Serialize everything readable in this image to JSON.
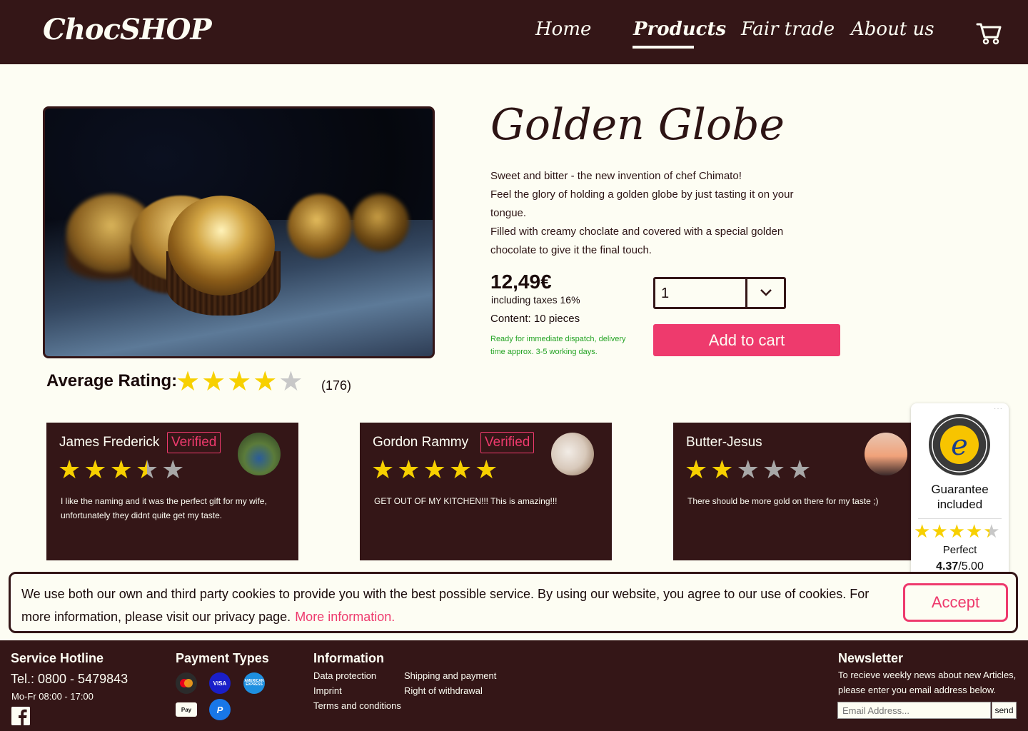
{
  "header": {
    "logo": "ChocSHOP",
    "nav": [
      {
        "label": "Home"
      },
      {
        "label": "Products",
        "active": true
      },
      {
        "label": "Fair trade"
      },
      {
        "label": "About us"
      }
    ],
    "cart_icon": "shopping-cart-icon"
  },
  "product": {
    "title": "Golden Globe",
    "description": [
      "Sweet and bitter - the new invention of chef Chimato!",
      "Feel the glory of holding a golden globe by just tasting it on your tongue.",
      "Filled with creamy choclate and covered with a special golden chocolate to give it the final touch."
    ],
    "price": "12,49€",
    "tax": "including taxes 16%",
    "content": "Content: 10 pieces",
    "dispatch": "Ready for immediate dispatch, delivery time approx. 3-5 working days.",
    "quantity": "1",
    "add_to_cart": "Add to cart"
  },
  "rating": {
    "label": "Average Rating:",
    "stars": 4,
    "max": 5,
    "count": "(176)"
  },
  "reviews": [
    {
      "name": "James Frederick",
      "verified": "Verified",
      "stars": 3.5,
      "text": "I like the naming and it was the perfect gift for my wife, unfortunately they didnt quite get my taste."
    },
    {
      "name": "Gordon Rammy",
      "verified": "Verified",
      "stars": 5,
      "text": "GET OUT OF MY KITCHEN!!! This is amazing!!!"
    },
    {
      "name": "Butter-Jesus",
      "verified": "",
      "stars": 2,
      "text": "There should be more gold on there for my taste ;)"
    }
  ],
  "trusted_shops": {
    "guarantee": "Guarantee included",
    "label": "Perfect",
    "score": "4.37",
    "max": "/5.00",
    "stars": 4.37
  },
  "cookie": {
    "text": "We use both our own and third party cookies to provide you with the best possible service. By using our website, you agree to our use of cookies. For more information, please visit our privacy page.",
    "link": "More information.",
    "accept": "Accept"
  },
  "footer": {
    "hotline_heading": "Service Hotline",
    "tel": "Tel.: 0800 - 5479843",
    "hours": "Mo-Fr 08:00 - 17:00",
    "payment_heading": "Payment Types",
    "payments": [
      "Mastercard",
      "VISA",
      "AMERICAN EXPRESS",
      "Apple Pay",
      "PayPal"
    ],
    "info_heading": "Information",
    "links_col1": [
      "Data protection",
      "Imprint",
      "Terms and conditions"
    ],
    "links_col2": [
      "Shipping and payment",
      "Right of withdrawal"
    ],
    "newsletter_heading": "Newsletter",
    "newsletter_text": "To recieve weekly news about new Articles, please enter you email address below.",
    "email_placeholder": "Email Address...",
    "send": "send"
  },
  "colors": {
    "brown": "#341617",
    "pink": "#ee3a6d",
    "cream": "#fdfdf3",
    "star": "#f7d000",
    "green": "#24a324"
  }
}
